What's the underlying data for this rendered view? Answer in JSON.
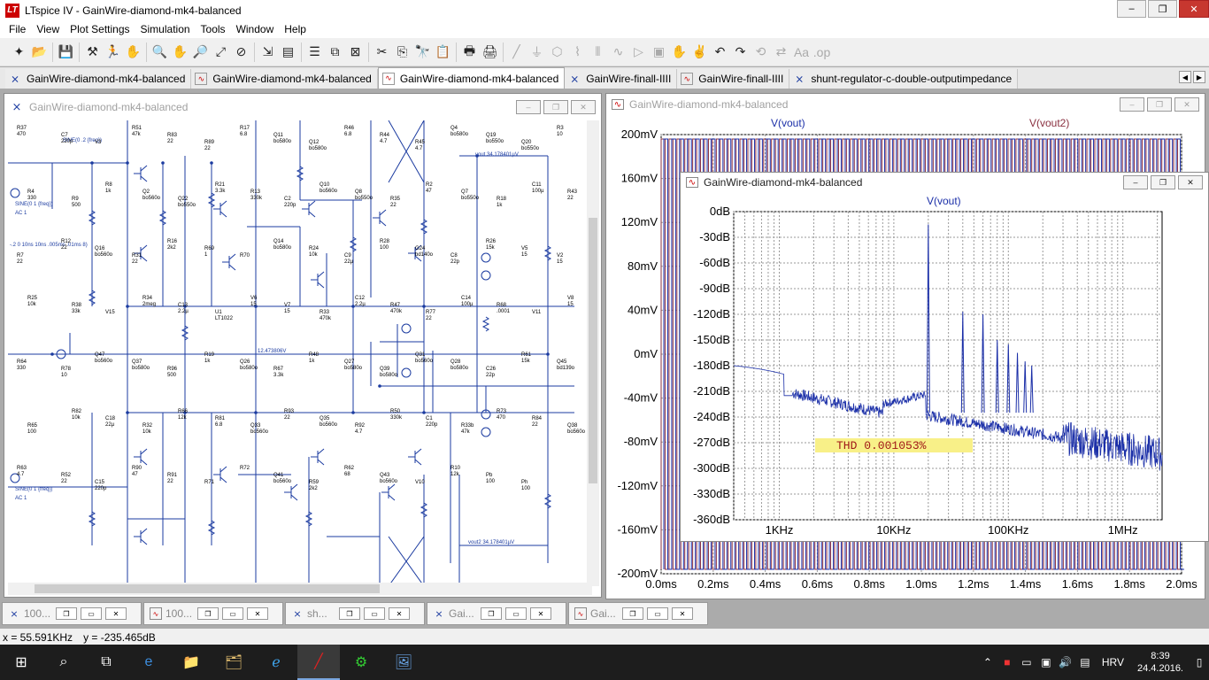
{
  "window": {
    "title": "LTspice IV - GainWire-diamond-mk4-balanced",
    "app_icon": "LT"
  },
  "menu": [
    "File",
    "View",
    "Plot Settings",
    "Simulation",
    "Tools",
    "Window",
    "Help"
  ],
  "tabs": [
    {
      "label": "GainWire-diamond-mk4-balanced",
      "type": "schematic-icon"
    },
    {
      "label": "GainWire-diamond-mk4-balanced",
      "type": "plot-icon"
    },
    {
      "label": "GainWire-diamond-mk4-balanced",
      "type": "plot-icon",
      "active": true
    },
    {
      "label": "GainWire-finall-IIII",
      "type": "schematic-icon"
    },
    {
      "label": "GainWire-finall-IIII",
      "type": "plot-icon"
    },
    {
      "label": "shunt-regulator-c-double-outputimpedance",
      "type": "schematic-icon"
    }
  ],
  "schematic": {
    "title": "GainWire-diamond-mk4-balanced",
    "labels": {
      "sine1": "SINE(0 .2 {freq})",
      "vout_label": "vout  34.178401µV",
      "vout2_label": "vout2  34.178401µV",
      "node_voltage": "12.473806V",
      "pulse": "-.2 0 10ns 10ns .005ms .01ms 8)",
      "v3_src": "SINE(0 1 {freq})",
      "v3_ac": "AC 1",
      "v10_src": "SINE(0 1 {freq})",
      "v10_ac": "AC 1"
    },
    "components": [
      {
        "ref": "R37",
        "val": "470"
      },
      {
        "ref": "C7",
        "val": "220p"
      },
      {
        "ref": "V3",
        "val": ""
      },
      {
        "ref": "R51",
        "val": "47k"
      },
      {
        "ref": "R83",
        "val": "22"
      },
      {
        "ref": "R89",
        "val": "22"
      },
      {
        "ref": "R17",
        "val": "6.8"
      },
      {
        "ref": "Q11",
        "val": "bo580o"
      },
      {
        "ref": "Q12",
        "val": "bo580o"
      },
      {
        "ref": "R46",
        "val": "6.8"
      },
      {
        "ref": "R44",
        "val": "4.7"
      },
      {
        "ref": "R45",
        "val": "4.7"
      },
      {
        "ref": "Q4",
        "val": "bo580o"
      },
      {
        "ref": "Q19",
        "val": "bo550o"
      },
      {
        "ref": "Q20",
        "val": "bo550o"
      },
      {
        "ref": "R3",
        "val": "10"
      },
      {
        "ref": "R4",
        "val": "330"
      },
      {
        "ref": "R9",
        "val": "500"
      },
      {
        "ref": "R8",
        "val": "1k"
      },
      {
        "ref": "Q2",
        "val": "bo560o"
      },
      {
        "ref": "Q22",
        "val": "bo550o"
      },
      {
        "ref": "R21",
        "val": "3.3k"
      },
      {
        "ref": "R13",
        "val": "330k"
      },
      {
        "ref": "C2",
        "val": "220p"
      },
      {
        "ref": "Q10",
        "val": "bo560o"
      },
      {
        "ref": "Q8",
        "val": "bo550o"
      },
      {
        "ref": "R35",
        "val": "22"
      },
      {
        "ref": "R2",
        "val": "47"
      },
      {
        "ref": "Q7",
        "val": "bo550o"
      },
      {
        "ref": "R18",
        "val": "1k"
      },
      {
        "ref": "C11",
        "val": "100µ"
      },
      {
        "ref": "R43",
        "val": "22"
      },
      {
        "ref": "R7",
        "val": "22"
      },
      {
        "ref": "R12",
        "val": "22"
      },
      {
        "ref": "Q16",
        "val": "bo560o"
      },
      {
        "ref": "R31",
        "val": "22"
      },
      {
        "ref": "R16",
        "val": "2k2"
      },
      {
        "ref": "R69",
        "val": "1"
      },
      {
        "ref": "R70",
        "val": ""
      },
      {
        "ref": "Q14",
        "val": "bo580o"
      },
      {
        "ref": "R24",
        "val": "10k"
      },
      {
        "ref": "C9",
        "val": "22µ"
      },
      {
        "ref": "R28",
        "val": "100"
      },
      {
        "ref": "G24",
        "val": "bd140o"
      },
      {
        "ref": "C8",
        "val": "22p"
      },
      {
        "ref": "R26",
        "val": "15k"
      },
      {
        "ref": "V5",
        "val": "15"
      },
      {
        "ref": "V2",
        "val": "15"
      },
      {
        "ref": "R25",
        "val": "10k"
      },
      {
        "ref": "R38",
        "val": "33k"
      },
      {
        "ref": "V15",
        "val": ""
      },
      {
        "ref": "R34",
        "val": "2meg"
      },
      {
        "ref": "C13",
        "val": "2.2µ"
      },
      {
        "ref": "U1",
        "val": "LT1022"
      },
      {
        "ref": "V6",
        "val": "15"
      },
      {
        "ref": "V7",
        "val": "15"
      },
      {
        "ref": "R33",
        "val": "470k"
      },
      {
        "ref": "C12",
        "val": "2.2µ"
      },
      {
        "ref": "R47",
        "val": "470k"
      },
      {
        "ref": "R77",
        "val": "22"
      },
      {
        "ref": "C14",
        "val": "100µ"
      },
      {
        "ref": "R68",
        "val": ".0001"
      },
      {
        "ref": "V11",
        "val": ""
      },
      {
        "ref": "V8",
        "val": "15"
      },
      {
        "ref": "R64",
        "val": "330"
      },
      {
        "ref": "R78",
        "val": "10"
      },
      {
        "ref": "Q47",
        "val": "bo560o"
      },
      {
        "ref": "Q37",
        "val": "bo580o"
      },
      {
        "ref": "R96",
        "val": "500"
      },
      {
        "ref": "R19",
        "val": "1k"
      },
      {
        "ref": "Q26",
        "val": "bo580o"
      },
      {
        "ref": "R67",
        "val": "3.3k"
      },
      {
        "ref": "R48",
        "val": "1k"
      },
      {
        "ref": "Q27",
        "val": "bo580o"
      },
      {
        "ref": "Q39",
        "val": "bo580o"
      },
      {
        "ref": "Q31",
        "val": "bo560o"
      },
      {
        "ref": "Q28",
        "val": "bo580o"
      },
      {
        "ref": "C26",
        "val": "22p"
      },
      {
        "ref": "R61",
        "val": "15k"
      },
      {
        "ref": "Q45",
        "val": "bd139o"
      },
      {
        "ref": "R65",
        "val": "100"
      },
      {
        "ref": "R82",
        "val": "10k"
      },
      {
        "ref": "C18",
        "val": "22µ"
      },
      {
        "ref": "R32",
        "val": "10k"
      },
      {
        "ref": "R66",
        "val": "12k"
      },
      {
        "ref": "R81",
        "val": "6.8"
      },
      {
        "ref": "Q33",
        "val": "bo560o"
      },
      {
        "ref": "R93",
        "val": "22"
      },
      {
        "ref": "Q35",
        "val": "bo560o"
      },
      {
        "ref": "R92",
        "val": "4.7"
      },
      {
        "ref": "R50",
        "val": "330k"
      },
      {
        "ref": "C1",
        "val": "220p"
      },
      {
        "ref": "R33b",
        "val": "47k"
      },
      {
        "ref": "R73",
        "val": "470"
      },
      {
        "ref": "R84",
        "val": "22"
      },
      {
        "ref": "Q38",
        "val": "bo560o"
      },
      {
        "ref": "R63",
        "val": "4.7"
      },
      {
        "ref": "R52",
        "val": "22"
      },
      {
        "ref": "C15",
        "val": "220p"
      },
      {
        "ref": "R90",
        "val": "47"
      },
      {
        "ref": "R91",
        "val": "22"
      },
      {
        "ref": "R71",
        "val": ""
      },
      {
        "ref": "R72",
        "val": ""
      },
      {
        "ref": "Q41",
        "val": "bo560o"
      },
      {
        "ref": "R59",
        "val": "2k2"
      },
      {
        "ref": "R62",
        "val": "68"
      },
      {
        "ref": "Q43",
        "val": "bo560o"
      },
      {
        "ref": "V10",
        "val": ""
      },
      {
        "ref": "R10",
        "val": "12k"
      },
      {
        "ref": "Pb",
        "val": "100"
      },
      {
        "ref": "Ph",
        "val": "100"
      }
    ]
  },
  "wave_plot": {
    "title": "GainWire-diamond-mk4-balanced",
    "trace1": "V(vout)",
    "trace2": "V(vout2)",
    "y_ticks": [
      "200mV",
      "160mV",
      "120mV",
      "80mV",
      "40mV",
      "0mV",
      "-40mV",
      "-80mV",
      "-120mV",
      "-160mV",
      "-200mV"
    ],
    "x_ticks": [
      "0.0ms",
      "0.2ms",
      "0.4ms",
      "0.6ms",
      "0.8ms",
      "1.0ms",
      "1.2ms",
      "1.4ms",
      "1.6ms",
      "1.8ms",
      "2.0ms"
    ]
  },
  "fft_plot": {
    "title": "GainWire-diamond-mk4-balanced",
    "trace": "V(vout)",
    "y_ticks": [
      "0dB",
      "-30dB",
      "-60dB",
      "-90dB",
      "-120dB",
      "-150dB",
      "-180dB",
      "-210dB",
      "-240dB",
      "-270dB",
      "-300dB",
      "-330dB",
      "-360dB"
    ],
    "x_ticks": [
      "1KHz",
      "10KHz",
      "100KHz",
      "1MHz"
    ],
    "thd_label": "THD  0.001053%"
  },
  "minimized_windows": [
    {
      "label": "100...",
      "type": "schematic-icon"
    },
    {
      "label": "100...",
      "type": "plot-icon"
    },
    {
      "label": "sh...",
      "type": "schematic-icon"
    },
    {
      "label": "Gai...",
      "type": "schematic-icon"
    },
    {
      "label": "Gai...",
      "type": "plot-icon"
    }
  ],
  "status": {
    "x": "x = 55.591KHz",
    "y": "y = -235.465dB"
  },
  "taskbar": {
    "language": "HRV",
    "time": "8:39",
    "date": "24.4.2016."
  },
  "colors": {
    "trace_blue": "#1b2fa8",
    "trace_red": "#8a3040",
    "grid": "#9a9a9a",
    "thd_bg": "#f8f088"
  }
}
